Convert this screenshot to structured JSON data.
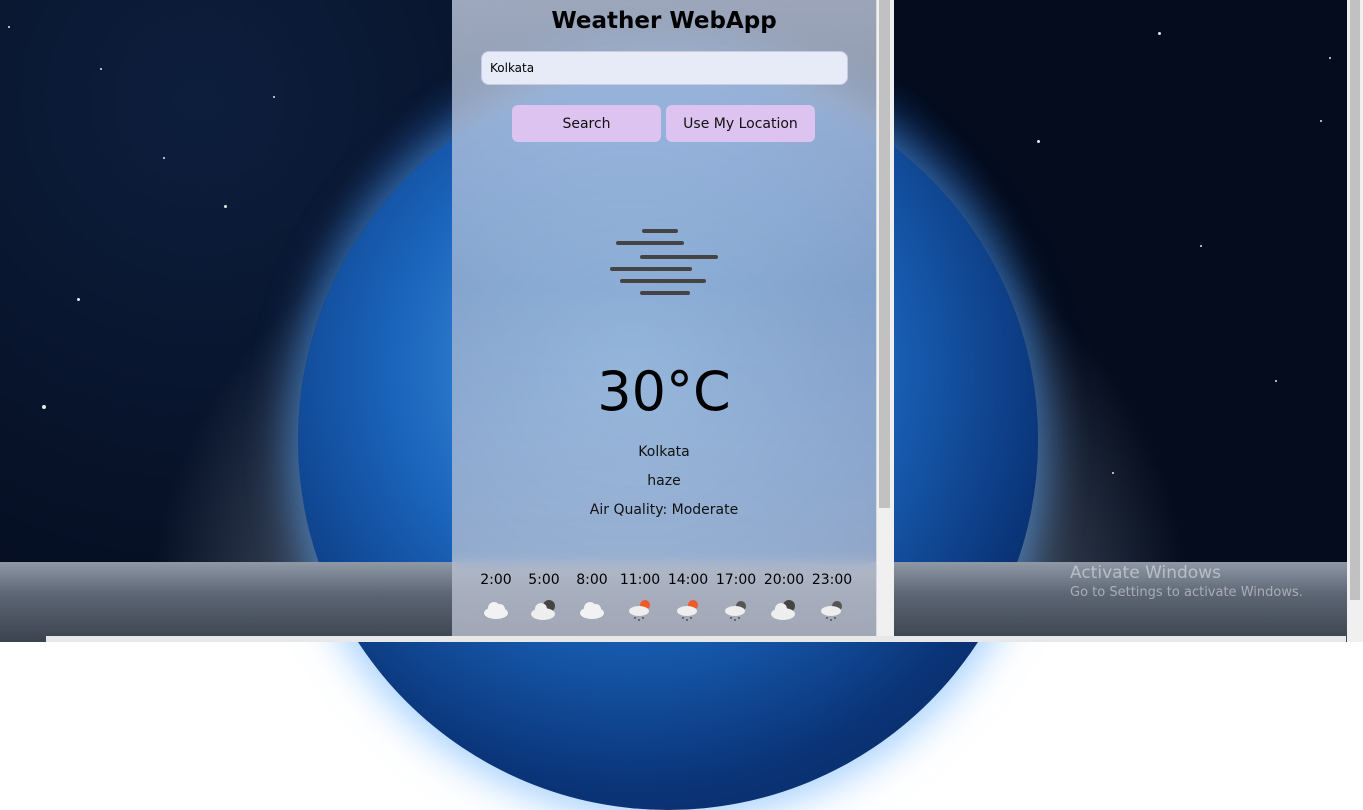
{
  "app": {
    "title": "Weather WebApp"
  },
  "search": {
    "value": "Kolkata",
    "search_label": "Search",
    "location_label": "Use My Location"
  },
  "current": {
    "icon": "haze-icon",
    "temperature": "30°C",
    "city": "Kolkata",
    "condition": "haze",
    "air_quality": "Air Quality: Moderate"
  },
  "forecast": [
    {
      "time": "2:00",
      "icon": "cloud-icon"
    },
    {
      "time": "5:00",
      "icon": "dark-clouds-icon"
    },
    {
      "time": "8:00",
      "icon": "cloud-icon"
    },
    {
      "time": "11:00",
      "icon": "sun-rain-icon"
    },
    {
      "time": "14:00",
      "icon": "sun-rain-icon"
    },
    {
      "time": "17:00",
      "icon": "rain-cloud-icon"
    },
    {
      "time": "20:00",
      "icon": "dark-clouds-icon"
    },
    {
      "time": "23:00",
      "icon": "rain-cloud-icon"
    }
  ],
  "watermark": {
    "line1": "Activate Windows",
    "line2": "Go to Settings to activate Windows."
  },
  "colors": {
    "button": "#dcc3f0",
    "input": "#e7ebf8"
  }
}
